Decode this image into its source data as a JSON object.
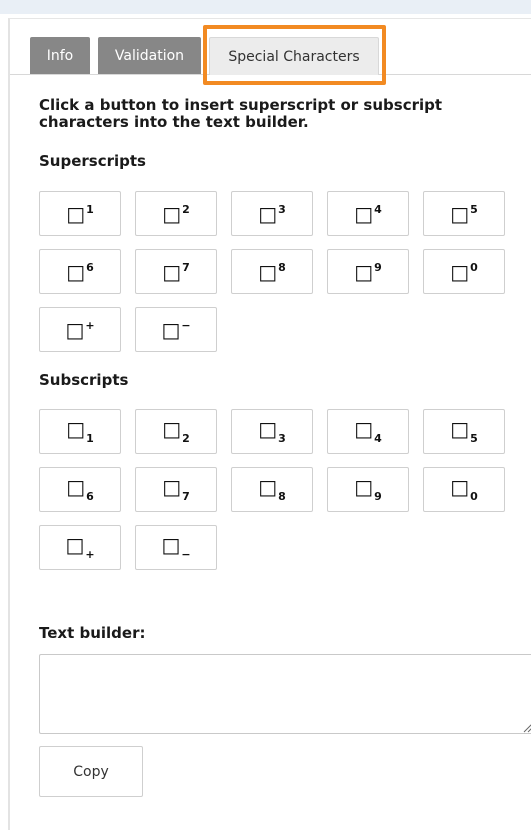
{
  "tabs": {
    "info": "Info",
    "validation": "Validation",
    "special": "Special Characters",
    "active": "Special Characters",
    "highlight_color": "#f28a22"
  },
  "instructions": "Click a button to insert superscript or subscript characters into the text builder.",
  "superscripts": {
    "heading": "Superscripts",
    "base_glyph": "□",
    "items": [
      "1",
      "2",
      "3",
      "4",
      "5",
      "6",
      "7",
      "8",
      "9",
      "0",
      "+",
      "−"
    ]
  },
  "subscripts": {
    "heading": "Subscripts",
    "base_glyph": "□",
    "items": [
      "1",
      "2",
      "3",
      "4",
      "5",
      "6",
      "7",
      "8",
      "9",
      "0",
      "+",
      "−"
    ]
  },
  "text_builder": {
    "label": "Text builder:",
    "value": "",
    "copy_label": "Copy"
  }
}
